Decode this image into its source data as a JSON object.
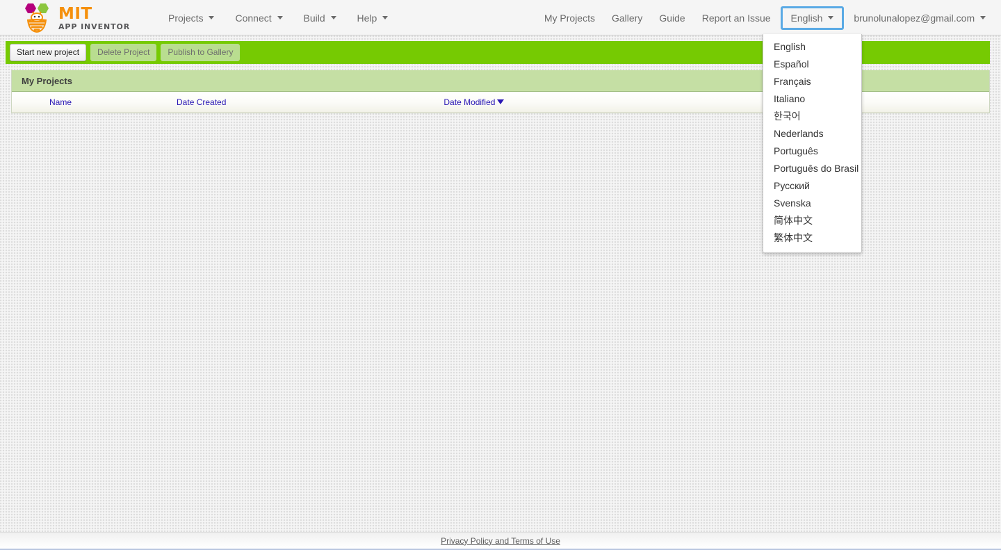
{
  "header": {
    "logo": {
      "icon": "mit-app-inventor-bee-logo",
      "title": "MIT",
      "subtitle": "APP INVENTOR",
      "colors": {
        "orange": "#f5900c",
        "magenta": "#b4007c",
        "green": "#8cc63e",
        "gray": "#58585a"
      }
    },
    "nav_left": [
      {
        "label": "Projects",
        "has_caret": true
      },
      {
        "label": "Connect",
        "has_caret": true
      },
      {
        "label": "Build",
        "has_caret": true
      },
      {
        "label": "Help",
        "has_caret": true
      }
    ],
    "nav_right": [
      {
        "label": "My Projects",
        "has_caret": false,
        "focused": false
      },
      {
        "label": "Gallery",
        "has_caret": false,
        "focused": false
      },
      {
        "label": "Guide",
        "has_caret": false,
        "focused": false
      },
      {
        "label": "Report an Issue",
        "has_caret": false,
        "focused": false
      },
      {
        "label": "English",
        "has_caret": true,
        "focused": true
      },
      {
        "label": "brunolunalopez@gmail.com",
        "has_caret": true,
        "focused": false
      }
    ],
    "focus_ring_color": "#5aaae5"
  },
  "language_menu": {
    "open": true,
    "selected": "English",
    "items": [
      "English",
      "Español",
      "Français",
      "Italiano",
      "한국어",
      "Nederlands",
      "Português",
      "Português do Brasil",
      "Русский",
      "Svenska",
      "简体中文",
      "繁体中文"
    ]
  },
  "toolbar": {
    "background_color": "#76ca02",
    "buttons": [
      {
        "label": "Start new project",
        "enabled": true
      },
      {
        "label": "Delete Project",
        "enabled": false
      },
      {
        "label": "Publish to Gallery",
        "enabled": false
      }
    ]
  },
  "projects_panel": {
    "title": "My Projects",
    "header_color": "#c5dfa4",
    "columns": [
      {
        "label": "Name",
        "sorted": false,
        "sort_dir": ""
      },
      {
        "label": "Date Created",
        "sorted": false,
        "sort_dir": ""
      },
      {
        "label": "Date Modified",
        "sorted": true,
        "sort_dir": "descending"
      }
    ],
    "rows": [],
    "link_color": "#2a18b5"
  },
  "footer": {
    "link_label": "Privacy Policy and Terms of Use"
  }
}
